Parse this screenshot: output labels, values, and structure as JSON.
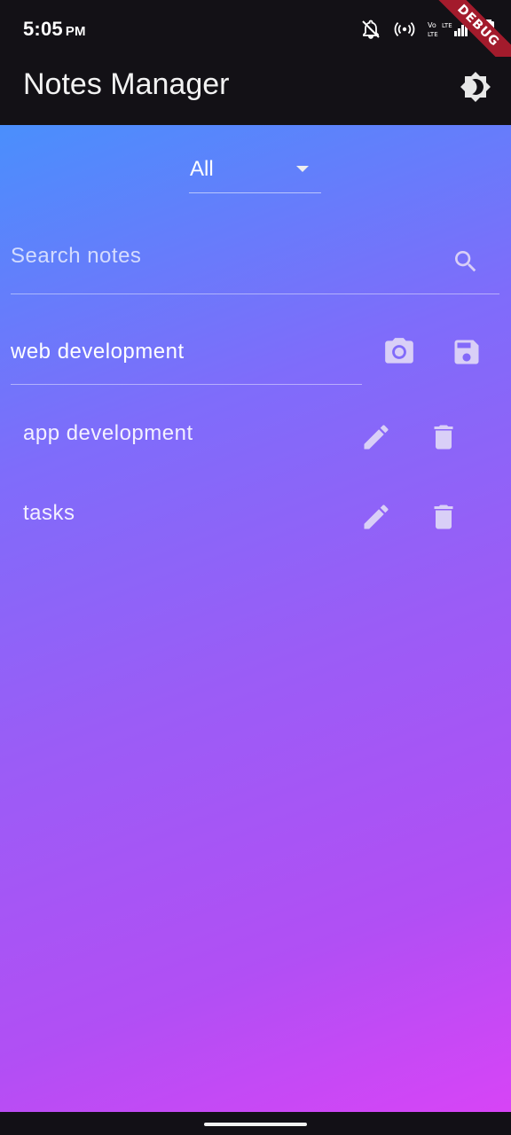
{
  "status_bar": {
    "time": "5:05",
    "ampm": "PM",
    "icons": [
      "notifications-off-icon",
      "hotspot-icon",
      "volte-icon",
      "signal-icon",
      "battery-icon"
    ],
    "debug_label": "DEBUG"
  },
  "app_bar": {
    "title": "Notes Manager",
    "theme_icon": "brightness-icon"
  },
  "filter": {
    "selected": "All"
  },
  "search": {
    "placeholder": "Search notes",
    "value": ""
  },
  "new_note": {
    "value": "web development",
    "camera_icon": "camera-icon",
    "save_icon": "save-icon"
  },
  "notes": [
    {
      "title": "app development"
    },
    {
      "title": "tasks"
    }
  ],
  "colors": {
    "gradient_start": "#4a8ffc",
    "gradient_end": "#d744f6",
    "bar_bg": "#131116",
    "icon": "#d9cff7"
  }
}
